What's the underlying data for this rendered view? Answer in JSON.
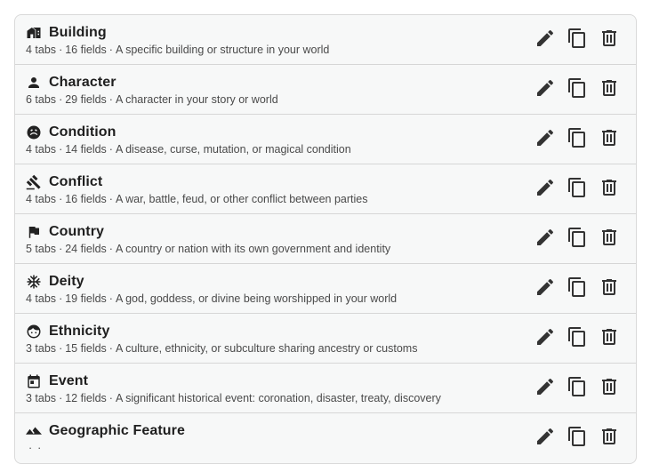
{
  "separator": "·",
  "icons": {
    "edit": "pencil-icon",
    "duplicate": "copy-icon",
    "delete": "trash-icon"
  },
  "templates": [
    {
      "icon": "building-icon",
      "name": "Building",
      "tabs": "4 tabs",
      "fields": "16 fields",
      "description": "A specific building or structure in your world"
    },
    {
      "icon": "person-icon",
      "name": "Character",
      "tabs": "6 tabs",
      "fields": "29 fields",
      "description": "A character in your story or world"
    },
    {
      "icon": "condition-icon",
      "name": "Condition",
      "tabs": "4 tabs",
      "fields": "14 fields",
      "description": "A disease, curse, mutation, or magical condition"
    },
    {
      "icon": "gavel-icon",
      "name": "Conflict",
      "tabs": "4 tabs",
      "fields": "16 fields",
      "description": "A war, battle, feud, or other conflict between parties"
    },
    {
      "icon": "flag-icon",
      "name": "Country",
      "tabs": "5 tabs",
      "fields": "24 fields",
      "description": "A country or nation with its own government and identity"
    },
    {
      "icon": "snowflake-icon",
      "name": "Deity",
      "tabs": "4 tabs",
      "fields": "19 fields",
      "description": "A god, goddess, or divine being worshipped in your world"
    },
    {
      "icon": "face-icon",
      "name": "Ethnicity",
      "tabs": "3 tabs",
      "fields": "15 fields",
      "description": "A culture, ethnicity, or subculture sharing ancestry or customs"
    },
    {
      "icon": "calendar-icon",
      "name": "Event",
      "tabs": "3 tabs",
      "fields": "12 fields",
      "description": "A significant historical event: coronation, disaster, treaty, discovery"
    },
    {
      "icon": "mountain-icon",
      "name": "Geographic Feature",
      "tabs": "",
      "fields": "",
      "description": ""
    }
  ]
}
